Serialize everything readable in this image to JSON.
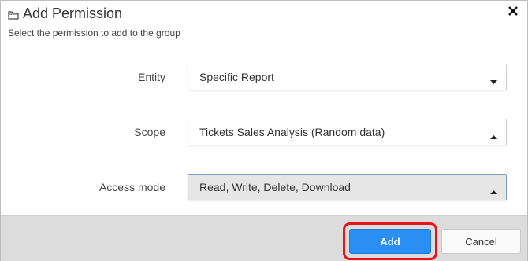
{
  "dialog": {
    "title": "Add Permission",
    "subtitle": "Select the permission to add to the group",
    "title_icon": "folder-icon",
    "close_icon": "close-icon"
  },
  "fields": [
    {
      "label": "Entity",
      "value": "Specific Report",
      "caret": "down"
    },
    {
      "label": "Scope",
      "value": "Tickets Sales Analysis (Random data)",
      "caret": "up"
    },
    {
      "label": "Access mode",
      "value": "Read, Write, Delete, Download",
      "caret": "up"
    }
  ],
  "footer": {
    "add_label": "Add",
    "cancel_label": "Cancel"
  },
  "colors": {
    "primary": "#2a8ef2",
    "highlight": "#e3141a",
    "footer_bg": "#dcdcdc"
  }
}
